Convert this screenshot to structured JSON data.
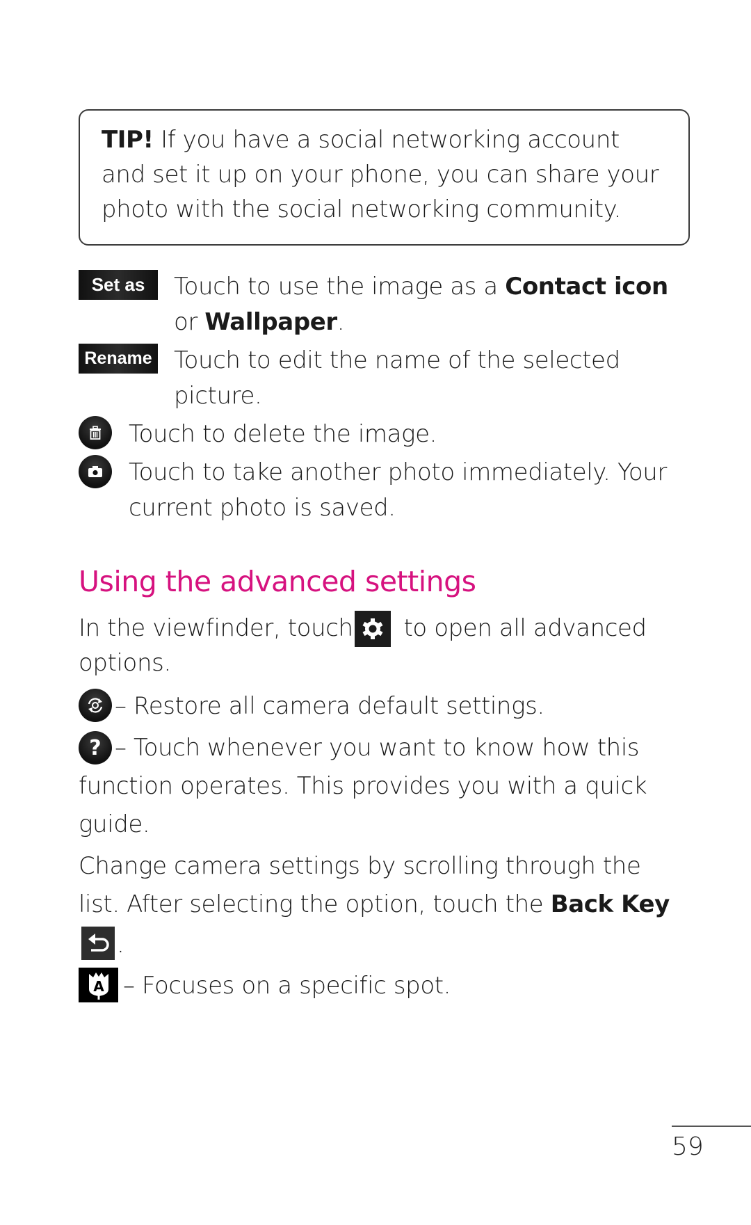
{
  "tip": {
    "label": "TIP!",
    "lines": [
      " If you have a social networking account",
      "and set it up on your phone, you can share your",
      "photo with the social networking community."
    ]
  },
  "actions": {
    "set_as": {
      "button_label": "Set as",
      "line1_prefix": "Touch to use the image as a ",
      "line1_bold": "Contact icon",
      "line2_prefix": "or ",
      "line2_bold": "Wallpaper",
      "line2_suffix": "."
    },
    "rename": {
      "button_label": "Rename",
      "line1": "Touch to edit the name of the selected",
      "line2": "picture."
    },
    "delete": {
      "icon": "trash-icon",
      "line1": "Touch to delete the image."
    },
    "camera": {
      "icon": "camera-icon",
      "line1": "Touch to take another photo immediately. Your",
      "line2": "current photo is saved."
    }
  },
  "advanced": {
    "heading": "Using the advanced settings",
    "heading_color": "#d6127f",
    "intro_prefix": "In the viewfinder, touch ",
    "intro_icon": "settings-gear-icon",
    "intro_suffix": " to open all advanced",
    "intro_line2": "options.",
    "restore": {
      "icon": "restore-icon",
      "text": " – Restore all camera default settings."
    },
    "help": {
      "icon": "help-icon",
      "line1": " – Touch whenever you want to know how this",
      "line2": "function operates. This provides you with a quick",
      "line3": "guide."
    },
    "change": {
      "line1": "Change camera settings by scrolling through the",
      "line2_prefix": "list. After selecting the option, touch the ",
      "line2_bold": "Back Key",
      "line3_icon": "back-key-icon",
      "line3_suffix": "."
    },
    "focus": {
      "icon": "auto-focus-icon",
      "text": " – Focuses on a specific spot."
    }
  },
  "page_number": "59"
}
